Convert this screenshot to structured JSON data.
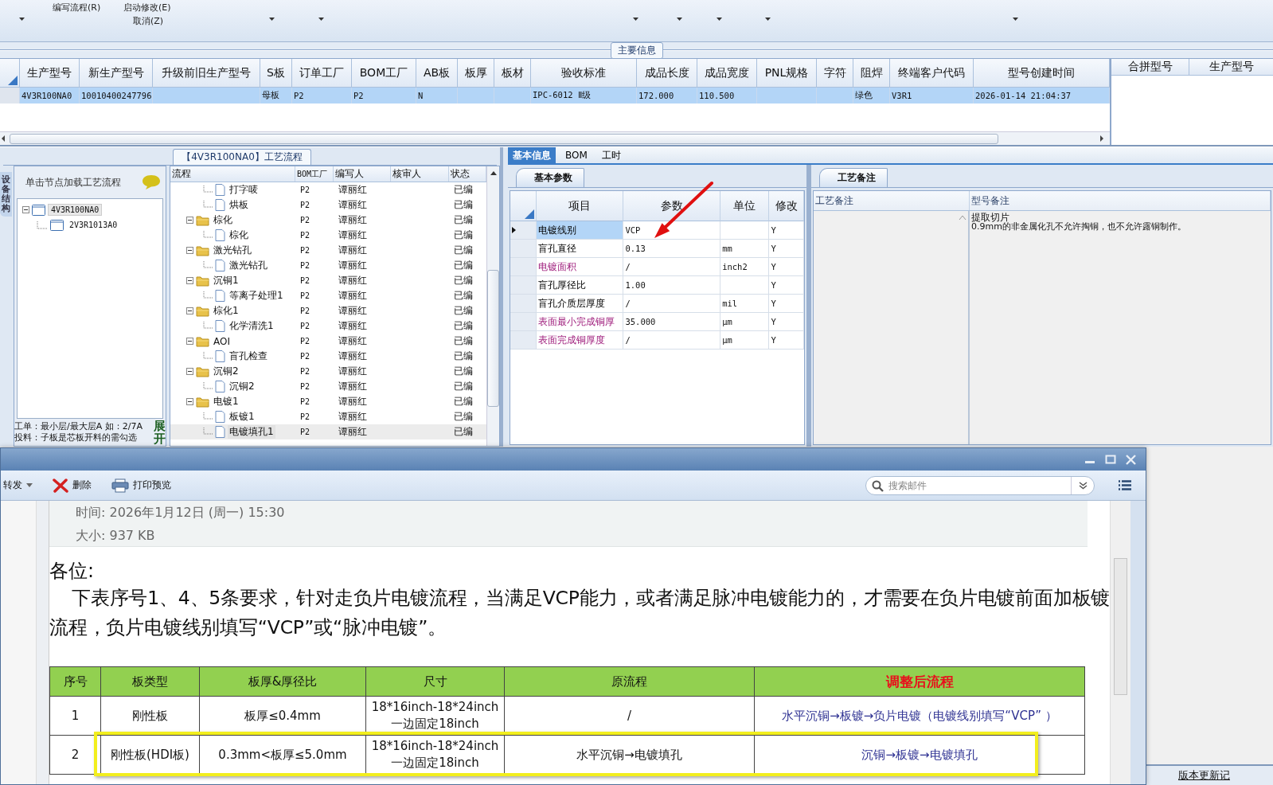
{
  "ribbon": {
    "commands": [
      {
        "label": "编写流程(R)"
      },
      {
        "label": "启动修改(E)"
      },
      {
        "label": "取消(Z)"
      }
    ]
  },
  "main_info": {
    "title": "主要信息",
    "columns": [
      "生产型号",
      "新生产型号",
      "升级前旧生产型号",
      "S板",
      "订单工厂",
      "BOM工厂",
      "AB板",
      "板厚",
      "板材",
      "验收标准",
      "成品长度",
      "成品宽度",
      "PNL规格",
      "字符",
      "阻焊",
      "终端客户代码",
      "型号创建时间"
    ],
    "rows": [
      {
        "selected": true,
        "cells": [
          "4V3R100NA0",
          "10010400247796",
          null,
          "母板",
          "P2",
          "P2",
          "N",
          null,
          null,
          "IPC-6012 Ⅱ级",
          "172.000",
          "110.500",
          null,
          null,
          "绿色",
          "V3R1",
          "2026-01-14 21:04:37"
        ]
      }
    ]
  },
  "merge_panel": {
    "columns": [
      "合拼型号",
      "生产型号"
    ]
  },
  "side_tab": {
    "label": "设备结构"
  },
  "node_tree": {
    "hint": "单击节点加载工艺流程",
    "nodes": [
      {
        "label": "4V3R100NA0",
        "selected": true,
        "expanded": true,
        "children": [
          {
            "label": "2V3R1013A0",
            "selected": false
          }
        ]
      }
    ]
  },
  "node_notes": [
    "工单：最小层/最大层A 如：2/7A",
    "投料：子板是芯板开料的需勾选"
  ],
  "expand_button": {
    "label": "展开"
  },
  "process_flow": {
    "title": "【4V3R100NA0】工艺流程",
    "columns": [
      "流程",
      "BOM工厂",
      "编写人",
      "核审人",
      "状态"
    ],
    "continued_children": [
      {
        "name": "打字唛",
        "factory": "P2",
        "writer": "谭丽红",
        "status": "已编",
        "selected": false
      },
      {
        "name": "烘板",
        "factory": "P2",
        "writer": "谭丽红",
        "status": "已编",
        "selected": false
      }
    ],
    "nodes": [
      {
        "name": "棕化",
        "factory": "P2",
        "writer": "谭丽红",
        "status": "已编",
        "selected": false,
        "expanded": true,
        "children": [
          {
            "name": "棕化",
            "factory": "P2",
            "writer": "谭丽红",
            "status": "已编",
            "selected": false
          }
        ]
      },
      {
        "name": "激光钻孔",
        "factory": "P2",
        "writer": "谭丽红",
        "status": "已编",
        "selected": false,
        "expanded": true,
        "children": [
          {
            "name": "激光钻孔",
            "factory": "P2",
            "writer": "谭丽红",
            "status": "已编",
            "selected": false
          }
        ]
      },
      {
        "name": "沉铜1",
        "factory": "P2",
        "writer": "谭丽红",
        "status": "已编",
        "selected": false,
        "expanded": true,
        "children": [
          {
            "name": "等离子处理1",
            "factory": "P2",
            "writer": "谭丽红",
            "status": "已编",
            "selected": false
          }
        ]
      },
      {
        "name": "棕化1",
        "factory": "P2",
        "writer": "谭丽红",
        "status": "已编",
        "selected": false,
        "expanded": true,
        "children": [
          {
            "name": "化学清洗1",
            "factory": "P2",
            "writer": "谭丽红",
            "status": "已编",
            "selected": false
          }
        ]
      },
      {
        "name": "AOI",
        "factory": "P2",
        "writer": "谭丽红",
        "status": "已编",
        "selected": false,
        "expanded": true,
        "children": [
          {
            "name": "盲孔检查",
            "factory": "P2",
            "writer": "谭丽红",
            "status": "已编",
            "selected": false
          }
        ]
      },
      {
        "name": "沉铜2",
        "factory": "P2",
        "writer": "谭丽红",
        "status": "已编",
        "selected": false,
        "expanded": true,
        "children": [
          {
            "name": "沉铜2",
            "factory": "P2",
            "writer": "谭丽红",
            "status": "已编",
            "selected": false
          }
        ]
      },
      {
        "name": "电镀1",
        "factory": "P2",
        "writer": "谭丽红",
        "status": "已编",
        "selected": false,
        "expanded": true,
        "children": [
          {
            "name": "板镀1",
            "factory": "P2",
            "writer": "谭丽红",
            "status": "已编",
            "selected": false
          },
          {
            "name": "电镀填孔1",
            "factory": "P2",
            "writer": "谭丽红",
            "status": "已编",
            "selected": true
          }
        ]
      }
    ]
  },
  "detail_tabs": [
    {
      "label": "基本信息",
      "selected": true
    },
    {
      "label": "BOM",
      "selected": false
    },
    {
      "label": "工时",
      "selected": false
    }
  ],
  "basic_params": {
    "tab": "基本参数",
    "columns": [
      "项目",
      "参数",
      "单位",
      "修改"
    ],
    "rows": [
      {
        "item": "电镀线别",
        "value": "VCP",
        "unit": null,
        "modified": "Y",
        "current": true,
        "kind": "standard"
      },
      {
        "item": "盲孔直径",
        "value": "0.13",
        "unit": "mm",
        "modified": "Y",
        "current": false,
        "kind": "standard"
      },
      {
        "item": "电镀面积",
        "value": "/",
        "unit": "inch2",
        "modified": "Y",
        "current": false,
        "kind": "flagged"
      },
      {
        "item": "盲孔厚径比",
        "value": "1.00",
        "unit": null,
        "modified": "Y",
        "current": false,
        "kind": "standard"
      },
      {
        "item": "盲孔介质层厚度",
        "value": "/",
        "unit": "mil",
        "modified": "Y",
        "current": false,
        "kind": "standard"
      },
      {
        "item": "表面最小完成铜厚",
        "value": "35.000",
        "unit": "μm",
        "modified": "Y",
        "current": false,
        "kind": "flagged"
      },
      {
        "item": "表面完成铜厚度",
        "value": "/",
        "unit": "μm",
        "modified": "Y",
        "current": false,
        "kind": "flagged"
      }
    ]
  },
  "remarks": {
    "tab": "工艺备注",
    "columns": [
      "工艺备注",
      "型号备注"
    ],
    "model_remark": [
      "提取切片",
      "0.9mm的非金属化孔不允许掏铜，也不允许露铜制作。"
    ]
  },
  "mail": {
    "toolbar": [
      {
        "label": "转发",
        "kind": "dropdown"
      },
      {
        "label": "删除",
        "kind": "delete"
      },
      {
        "label": "打印预览",
        "kind": "print"
      }
    ],
    "search": {
      "placeholder": "搜索邮件"
    },
    "meta": [
      "时间: 2026年1月12日 (周一) 15:30",
      "大小: 937 KB"
    ],
    "greeting": "各位:",
    "body": "下表序号1、4、5条要求，针对走负片电镀流程，当满足VCP能力，或者满足脉冲电镀能力的，才需要在负片电镀前面加板镀流程，负片电镀线别填写“VCP”或“脉冲电镀”。",
    "table": {
      "columns": [
        {
          "label": "序号",
          "kind": "plain"
        },
        {
          "label": "板类型",
          "kind": "plain"
        },
        {
          "label": "板厚&厚径比",
          "kind": "plain"
        },
        {
          "label": "尺寸",
          "kind": "plain"
        },
        {
          "label": "原流程",
          "kind": "plain"
        },
        {
          "label": "调整后流程",
          "kind": "emphasis"
        }
      ],
      "rows": [
        {
          "highlighted": false,
          "cells": [
            "1",
            "刚性板",
            "板厚≤0.4mm",
            "18*16inch-18*24inch\n一边固定18inch",
            "/",
            "水平沉铜→板镀→负片电镀（电镀线别填写“VCP” ）"
          ]
        },
        {
          "highlighted": true,
          "cells": [
            "2",
            "刚性板(HDI板)",
            "0.3mm<板厚≤5.0mm",
            "18*16inch-18*24inch\n一边固定18inch",
            "水平沉铜→电镀填孔",
            "沉铜→板镀→电镀填孔"
          ]
        }
      ]
    }
  },
  "status_bar": {
    "link": "版本更新记"
  }
}
